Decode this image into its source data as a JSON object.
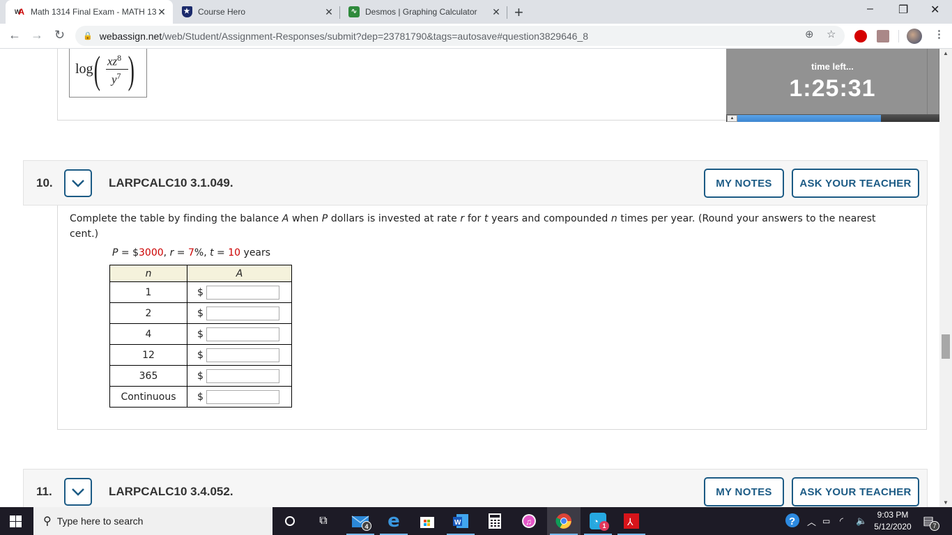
{
  "browser": {
    "tabs": [
      {
        "title": "Math 1314 Final Exam - MATH 13",
        "favicon": "webassign-icon",
        "active": true
      },
      {
        "title": "Course Hero",
        "favicon": "course-hero-icon",
        "active": false
      },
      {
        "title": "Desmos | Graphing Calculator",
        "favicon": "desmos-icon",
        "active": false
      }
    ],
    "new_tab_label": "+",
    "url_host": "webassign.net",
    "url_path": "/web/Student/Assignment-Responses/submit?dep=23781790&tags=autosave#question3829646_8",
    "window_controls": {
      "minimize": "–",
      "restore": "❐",
      "close": "✕"
    }
  },
  "previous_question": {
    "math_expression": {
      "func": "log",
      "numerator_vars": "xz",
      "numerator_exp": "8",
      "denominator_var": "y",
      "denominator_exp": "7"
    }
  },
  "timer": {
    "label": "time left...",
    "value": "1:25:31",
    "progress_fraction": 0.71
  },
  "questions": [
    {
      "number": "10.",
      "code": "LARPCALC10 3.1.049.",
      "my_notes_label": "MY NOTES",
      "ask_teacher_label": "ASK YOUR TEACHER",
      "prompt_parts": {
        "p1": "Complete the table by finding the balance ",
        "A": "A",
        "p2": " when ",
        "P": "P",
        "p3": " dollars is invested at rate ",
        "r": "r",
        "p4": " for ",
        "t": "t",
        "p5": " years and compounded ",
        "n": "n",
        "p6": " times per year. (Round your answers to the nearest cent.)"
      },
      "given": {
        "P_label": "P",
        "eq": " = ",
        "dollar": "$",
        "P_value": "3000",
        "r_label": "r",
        "r_value": "7",
        "percent": "%",
        "t_label": "t",
        "t_value": "10",
        "unit": "years",
        "sep": ", "
      },
      "table": {
        "headers": [
          "n",
          "A"
        ],
        "currency": "$",
        "rows": [
          {
            "n": "1",
            "value": ""
          },
          {
            "n": "2",
            "value": ""
          },
          {
            "n": "4",
            "value": ""
          },
          {
            "n": "12",
            "value": ""
          },
          {
            "n": "365",
            "value": ""
          },
          {
            "n": "Continuous",
            "value": ""
          }
        ]
      }
    },
    {
      "number": "11.",
      "code": "LARPCALC10 3.4.052.",
      "my_notes_label": "MY NOTES",
      "ask_teacher_label": "ASK YOUR TEACHER"
    }
  ],
  "taskbar": {
    "search_placeholder": "Type here to search",
    "mail_badge": "4",
    "app_badge": "1",
    "time": "9:03 PM",
    "date": "5/12/2020",
    "notifications_badge": "7"
  }
}
